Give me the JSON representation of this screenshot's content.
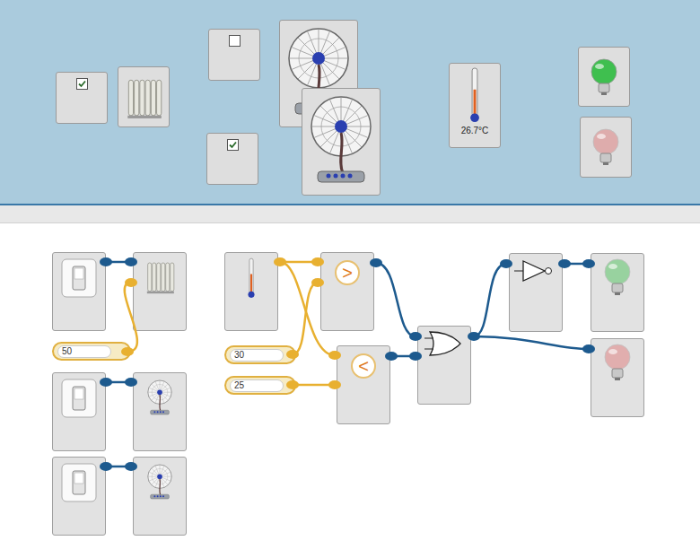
{
  "controls": {
    "heater": {
      "checked": true
    },
    "fans": [
      {
        "checked": false
      },
      {
        "checked": true
      }
    ]
  },
  "thermometer": {
    "reading": "26.7°C",
    "level": 0.55
  },
  "lamps": [
    {
      "name": "green",
      "lit": true,
      "color": "#3fbf4f"
    },
    {
      "name": "red",
      "lit": false,
      "color": "#e07070"
    }
  ],
  "circuit": {
    "devices": [
      {
        "kind": "heater"
      },
      {
        "kind": "fan"
      },
      {
        "kind": "fan"
      }
    ],
    "constants": [
      "50",
      "30",
      "25"
    ],
    "comparators": [
      ">",
      "<"
    ]
  }
}
